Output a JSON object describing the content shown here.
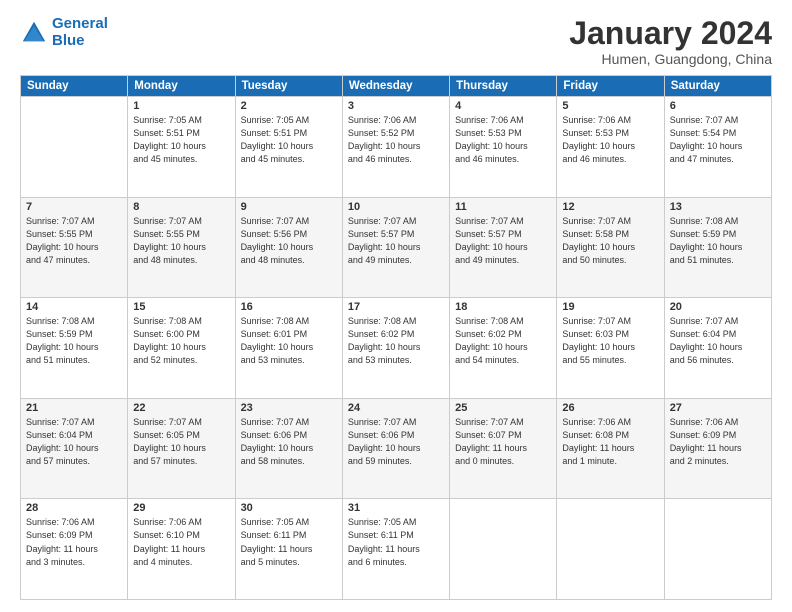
{
  "logo": {
    "line1": "General",
    "line2": "Blue"
  },
  "title": "January 2024",
  "subtitle": "Humen, Guangdong, China",
  "days_of_week": [
    "Sunday",
    "Monday",
    "Tuesday",
    "Wednesday",
    "Thursday",
    "Friday",
    "Saturday"
  ],
  "weeks": [
    [
      {
        "day": "",
        "info": ""
      },
      {
        "day": "1",
        "info": "Sunrise: 7:05 AM\nSunset: 5:51 PM\nDaylight: 10 hours\nand 45 minutes."
      },
      {
        "day": "2",
        "info": "Sunrise: 7:05 AM\nSunset: 5:51 PM\nDaylight: 10 hours\nand 45 minutes."
      },
      {
        "day": "3",
        "info": "Sunrise: 7:06 AM\nSunset: 5:52 PM\nDaylight: 10 hours\nand 46 minutes."
      },
      {
        "day": "4",
        "info": "Sunrise: 7:06 AM\nSunset: 5:53 PM\nDaylight: 10 hours\nand 46 minutes."
      },
      {
        "day": "5",
        "info": "Sunrise: 7:06 AM\nSunset: 5:53 PM\nDaylight: 10 hours\nand 46 minutes."
      },
      {
        "day": "6",
        "info": "Sunrise: 7:07 AM\nSunset: 5:54 PM\nDaylight: 10 hours\nand 47 minutes."
      }
    ],
    [
      {
        "day": "7",
        "info": "Sunrise: 7:07 AM\nSunset: 5:55 PM\nDaylight: 10 hours\nand 47 minutes."
      },
      {
        "day": "8",
        "info": "Sunrise: 7:07 AM\nSunset: 5:55 PM\nDaylight: 10 hours\nand 48 minutes."
      },
      {
        "day": "9",
        "info": "Sunrise: 7:07 AM\nSunset: 5:56 PM\nDaylight: 10 hours\nand 48 minutes."
      },
      {
        "day": "10",
        "info": "Sunrise: 7:07 AM\nSunset: 5:57 PM\nDaylight: 10 hours\nand 49 minutes."
      },
      {
        "day": "11",
        "info": "Sunrise: 7:07 AM\nSunset: 5:57 PM\nDaylight: 10 hours\nand 49 minutes."
      },
      {
        "day": "12",
        "info": "Sunrise: 7:07 AM\nSunset: 5:58 PM\nDaylight: 10 hours\nand 50 minutes."
      },
      {
        "day": "13",
        "info": "Sunrise: 7:08 AM\nSunset: 5:59 PM\nDaylight: 10 hours\nand 51 minutes."
      }
    ],
    [
      {
        "day": "14",
        "info": "Sunrise: 7:08 AM\nSunset: 5:59 PM\nDaylight: 10 hours\nand 51 minutes."
      },
      {
        "day": "15",
        "info": "Sunrise: 7:08 AM\nSunset: 6:00 PM\nDaylight: 10 hours\nand 52 minutes."
      },
      {
        "day": "16",
        "info": "Sunrise: 7:08 AM\nSunset: 6:01 PM\nDaylight: 10 hours\nand 53 minutes."
      },
      {
        "day": "17",
        "info": "Sunrise: 7:08 AM\nSunset: 6:02 PM\nDaylight: 10 hours\nand 53 minutes."
      },
      {
        "day": "18",
        "info": "Sunrise: 7:08 AM\nSunset: 6:02 PM\nDaylight: 10 hours\nand 54 minutes."
      },
      {
        "day": "19",
        "info": "Sunrise: 7:07 AM\nSunset: 6:03 PM\nDaylight: 10 hours\nand 55 minutes."
      },
      {
        "day": "20",
        "info": "Sunrise: 7:07 AM\nSunset: 6:04 PM\nDaylight: 10 hours\nand 56 minutes."
      }
    ],
    [
      {
        "day": "21",
        "info": "Sunrise: 7:07 AM\nSunset: 6:04 PM\nDaylight: 10 hours\nand 57 minutes."
      },
      {
        "day": "22",
        "info": "Sunrise: 7:07 AM\nSunset: 6:05 PM\nDaylight: 10 hours\nand 57 minutes."
      },
      {
        "day": "23",
        "info": "Sunrise: 7:07 AM\nSunset: 6:06 PM\nDaylight: 10 hours\nand 58 minutes."
      },
      {
        "day": "24",
        "info": "Sunrise: 7:07 AM\nSunset: 6:06 PM\nDaylight: 10 hours\nand 59 minutes."
      },
      {
        "day": "25",
        "info": "Sunrise: 7:07 AM\nSunset: 6:07 PM\nDaylight: 11 hours\nand 0 minutes."
      },
      {
        "day": "26",
        "info": "Sunrise: 7:06 AM\nSunset: 6:08 PM\nDaylight: 11 hours\nand 1 minute."
      },
      {
        "day": "27",
        "info": "Sunrise: 7:06 AM\nSunset: 6:09 PM\nDaylight: 11 hours\nand 2 minutes."
      }
    ],
    [
      {
        "day": "28",
        "info": "Sunrise: 7:06 AM\nSunset: 6:09 PM\nDaylight: 11 hours\nand 3 minutes."
      },
      {
        "day": "29",
        "info": "Sunrise: 7:06 AM\nSunset: 6:10 PM\nDaylight: 11 hours\nand 4 minutes."
      },
      {
        "day": "30",
        "info": "Sunrise: 7:05 AM\nSunset: 6:11 PM\nDaylight: 11 hours\nand 5 minutes."
      },
      {
        "day": "31",
        "info": "Sunrise: 7:05 AM\nSunset: 6:11 PM\nDaylight: 11 hours\nand 6 minutes."
      },
      {
        "day": "",
        "info": ""
      },
      {
        "day": "",
        "info": ""
      },
      {
        "day": "",
        "info": ""
      }
    ]
  ]
}
